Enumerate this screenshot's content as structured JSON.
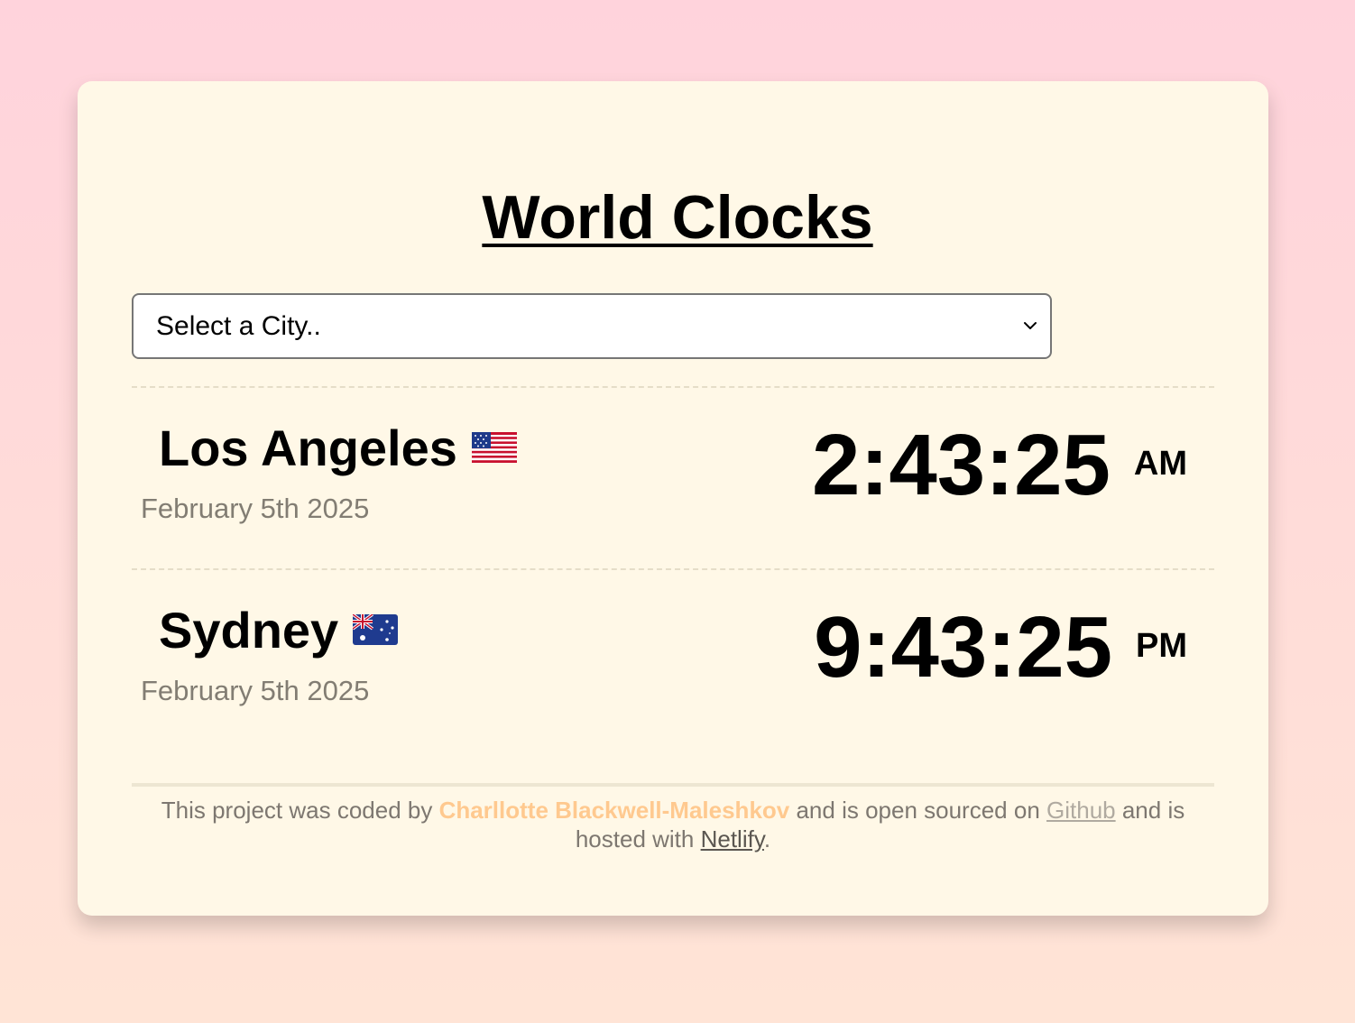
{
  "app": {
    "title": "World Clocks",
    "select": {
      "placeholder": "Select a City.."
    },
    "cities": [
      {
        "name": "Los Angeles",
        "flag_icon": "us-flag-icon",
        "date": "February 5th 2025",
        "time": "2:43:25",
        "ampm": "AM"
      },
      {
        "name": "Sydney",
        "flag_icon": "australia-flag-icon",
        "date": "February 5th 2025",
        "time": "9:43:25",
        "ampm": "PM"
      }
    ],
    "footer": {
      "text_1": "This project was coded by ",
      "author": "Charllotte Blackwell-Maleshkov",
      "text_2": " and is open sourced on ",
      "github_link": "Github",
      "text_3": " and is hosted with ",
      "netlify_link": "Netlify",
      "text_4": "."
    },
    "colors": {
      "background_top": "#ffd3dc",
      "background_bottom": "#ffe4d6",
      "card": "#fff8e7",
      "author_accent": "#ffc98f",
      "date_text": "#827d73"
    }
  }
}
